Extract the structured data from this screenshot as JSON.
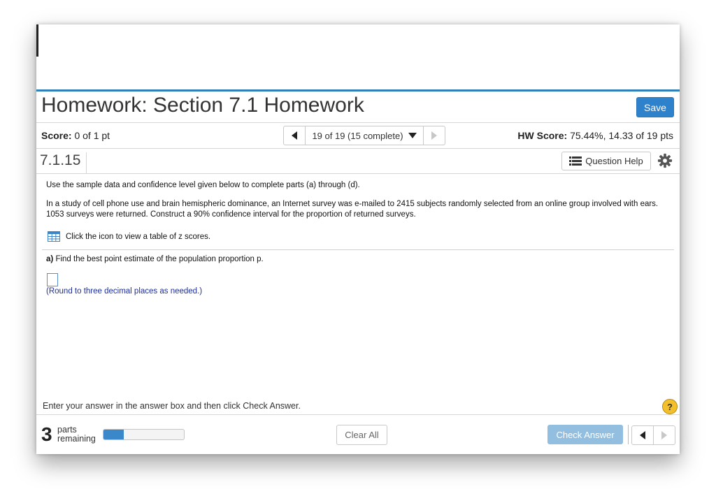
{
  "header": {
    "title": "Homework: Section 7.1 Homework",
    "save_label": "Save"
  },
  "score_bar": {
    "score_label": "Score:",
    "score_value": "0 of 1 pt",
    "nav_text": "19 of 19 (15 complete)",
    "hw_score_label": "HW Score:",
    "hw_score_value": "75.44%, 14.33 of 19 pts"
  },
  "question_bar": {
    "number": "7.1.15",
    "help_label": "Question Help"
  },
  "question": {
    "intro": "Use the sample data and confidence level given below to complete parts (a) through (d).",
    "text": "In a study of cell phone use and brain hemispheric dominance, an Internet survey was e-mailed to 2415 subjects randomly selected from an online group involved with ears. 1053 surveys were returned. Construct a 90% confidence interval for the proportion of returned surveys.",
    "table_link": "Click the icon to view a table of z scores.",
    "part_label": "a)",
    "part_text": "Find the best point estimate of the population proportion p.",
    "answer_value": "",
    "round_note": "(Round to three decimal places as needed.)"
  },
  "footer": {
    "instructions": "Enter your answer in the answer box and then click Check Answer.",
    "help_symbol": "?",
    "parts_count": "3",
    "parts_word": "parts",
    "remaining_word": "remaining",
    "progress_fraction": 0.25,
    "clear_label": "Clear All",
    "check_label": "Check Answer"
  },
  "colors": {
    "accent": "#2e82cc",
    "check_button": "#92bfe0",
    "help_icon": "#f3c02c",
    "round_note": "#1d2e9a"
  },
  "icons": [
    "prev-icon",
    "dropdown-icon",
    "next-icon",
    "list-icon",
    "gear-icon",
    "table-grid-icon",
    "help-icon"
  ]
}
